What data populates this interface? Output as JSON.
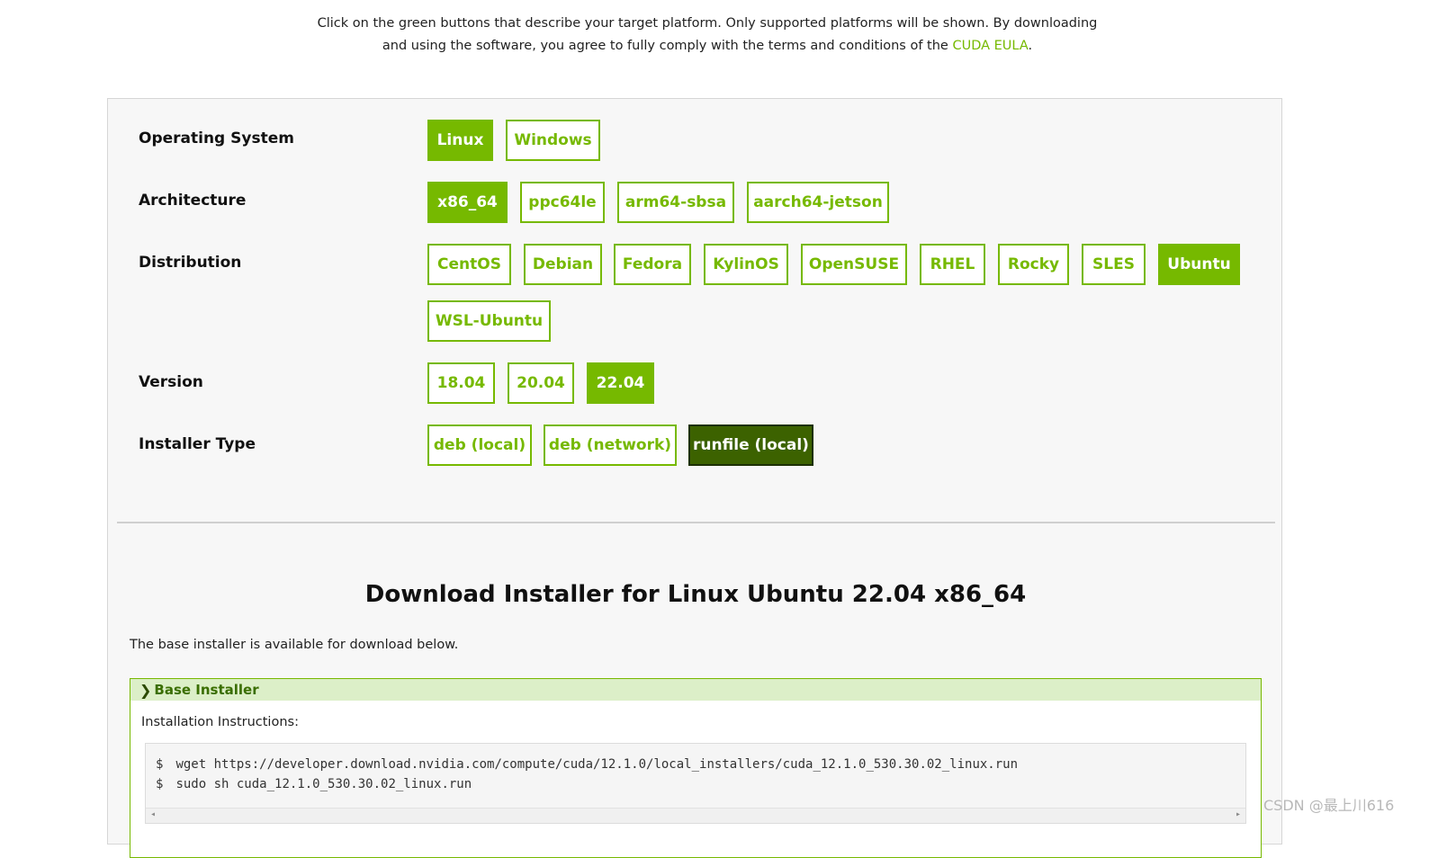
{
  "intro": {
    "line1": "Click on the green buttons that describe your target platform. Only supported platforms will be shown. By downloading",
    "line2_prefix": "and using the software, you agree to fully comply with the terms and conditions of the ",
    "eula_link": "CUDA EULA",
    "line2_suffix": "."
  },
  "rows": {
    "os": {
      "label": "Operating System",
      "options": [
        "Linux",
        "Windows"
      ],
      "selected": "Linux"
    },
    "arch": {
      "label": "Architecture",
      "options": [
        "x86_64",
        "ppc64le",
        "arm64-sbsa",
        "aarch64-jetson"
      ],
      "selected": "x86_64"
    },
    "dist": {
      "label": "Distribution",
      "options": [
        "CentOS",
        "Debian",
        "Fedora",
        "KylinOS",
        "OpenSUSE",
        "RHEL",
        "Rocky",
        "SLES",
        "Ubuntu",
        "WSL-Ubuntu"
      ],
      "selected": "Ubuntu"
    },
    "version": {
      "label": "Version",
      "options": [
        "18.04",
        "20.04",
        "22.04"
      ],
      "selected": "22.04"
    },
    "installer": {
      "label": "Installer Type",
      "options": [
        "deb (local)",
        "deb (network)",
        "runfile (local)"
      ],
      "selected": "runfile (local)"
    }
  },
  "download": {
    "title": "Download Installer for Linux Ubuntu 22.04 x86_64",
    "subtitle": "The base installer is available for download below.",
    "base_installer": {
      "header": "Base Installer",
      "instructions_label": "Installation Instructions:",
      "commands": [
        {
          "prompt": "$",
          "cmd": "wget https://developer.download.nvidia.com/compute/cuda/12.1.0/local_installers/cuda_12.1.0_530.30.02_linux.run"
        },
        {
          "prompt": "$",
          "cmd": "sudo sh cuda_12.1.0_530.30.02_linux.run"
        }
      ]
    }
  },
  "watermark": "CSDN @最上川616",
  "colors": {
    "accent": "#76b900",
    "selected_dark": "#3c6200",
    "panel_bg": "#f7f7f7"
  }
}
